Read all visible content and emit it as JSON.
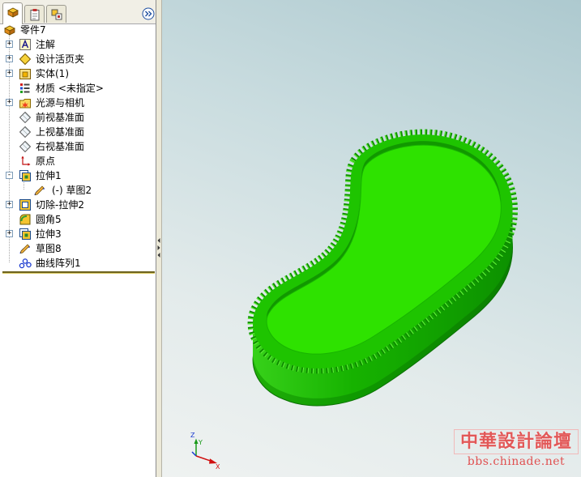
{
  "panel": {
    "tabs": [
      {
        "icon": "feature-manager-icon",
        "selected": true
      },
      {
        "icon": "property-manager-icon",
        "selected": false
      },
      {
        "icon": "configuration-manager-icon",
        "selected": false
      }
    ],
    "expand_icon": "double-chevron-right-icon"
  },
  "tree": {
    "root": {
      "label": "零件7",
      "icon": "part-icon"
    },
    "items": [
      {
        "label": "注解",
        "icon": "annotation-icon",
        "expander": "+"
      },
      {
        "label": "设计活页夹",
        "icon": "design-binder-icon",
        "expander": "+"
      },
      {
        "label": "实体(1)",
        "icon": "solid-bodies-icon",
        "expander": "+"
      },
      {
        "label": "材质 <未指定>",
        "icon": "material-icon"
      },
      {
        "label": "光源与相机",
        "icon": "lights-cameras-icon",
        "expander": "+"
      },
      {
        "label": "前视基准面",
        "icon": "plane-icon"
      },
      {
        "label": "上视基准面",
        "icon": "plane-icon"
      },
      {
        "label": "右视基准面",
        "icon": "plane-icon"
      },
      {
        "label": "原点",
        "icon": "origin-icon"
      },
      {
        "label": "拉伸1",
        "icon": "extrude-icon",
        "expander": "-",
        "children": [
          {
            "label": "(-) 草图2",
            "icon": "sketch-icon"
          }
        ]
      },
      {
        "label": "切除-拉伸2",
        "icon": "cut-extrude-icon",
        "expander": "+"
      },
      {
        "label": "圆角5",
        "icon": "fillet-icon"
      },
      {
        "label": "拉伸3",
        "icon": "extrude-icon",
        "expander": "+"
      },
      {
        "label": "草图8",
        "icon": "sketch-icon"
      },
      {
        "label": "曲线阵列1",
        "icon": "curve-pattern-icon"
      }
    ]
  },
  "viewport": {
    "model_colors": {
      "face": "#2ee200",
      "rim": "#1ec400",
      "wall": "#16b200",
      "teeth": "#0e8a00"
    },
    "triad": {
      "x": "X",
      "y": "Y",
      "z": "Z"
    }
  },
  "watermark": {
    "title": "中華設計論壇",
    "site": "bbs.chinade.net"
  }
}
